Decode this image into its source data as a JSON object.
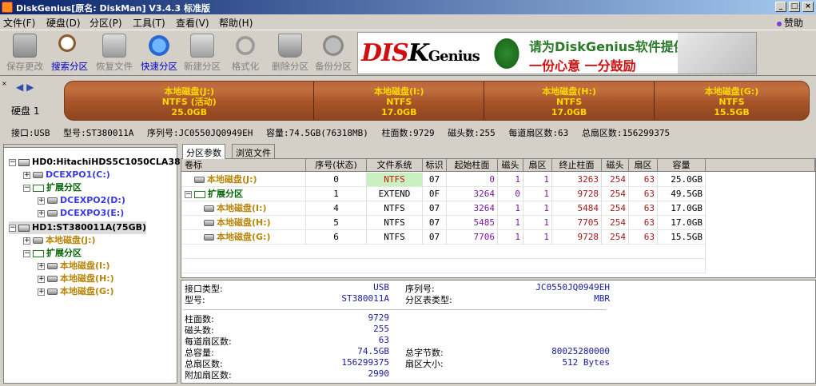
{
  "window": {
    "title": "DiskGenius[原名: DiskMan] V3.4.3 标准版",
    "controls": [
      "_",
      "□",
      "×"
    ]
  },
  "menu": {
    "items": [
      "文件(F)",
      "硬盘(D)",
      "分区(P)",
      "工具(T)",
      "查看(V)",
      "帮助(H)"
    ],
    "donate": "赞助"
  },
  "toolbar": {
    "buttons": [
      {
        "label": "保存更改",
        "icon": "save-icon",
        "enabled": false
      },
      {
        "label": "搜索分区",
        "icon": "search-icon",
        "enabled": true
      },
      {
        "label": "恢复文件",
        "icon": "recover-icon",
        "enabled": false
      },
      {
        "label": "快速分区",
        "icon": "quick-partition-icon",
        "enabled": true
      },
      {
        "label": "新建分区",
        "icon": "new-partition-icon",
        "enabled": false
      },
      {
        "label": "格式化",
        "icon": "format-icon",
        "enabled": false
      },
      {
        "label": "删除分区",
        "icon": "delete-partition-icon",
        "enabled": false
      },
      {
        "label": "备份分区",
        "icon": "backup-partition-icon",
        "enabled": false
      }
    ],
    "banner": {
      "logo_dis": "DIS",
      "logo_k": "K",
      "logo_genius": "Genius",
      "line1": "请为DiskGenius软件提供赞助",
      "line2": "一份心意  一分鼓励"
    }
  },
  "disk_bar": {
    "label": "硬盘 1",
    "segments": [
      {
        "name": "本地磁盘(J:)",
        "fs": "NTFS (活动)",
        "size": "25.0GB",
        "size_gb": 25.0
      },
      {
        "name": "本地磁盘(I:)",
        "fs": "NTFS",
        "size": "17.0GB",
        "size_gb": 17.0
      },
      {
        "name": "本地磁盘(H:)",
        "fs": "NTFS",
        "size": "17.0GB",
        "size_gb": 17.0
      },
      {
        "name": "本地磁盘(G:)",
        "fs": "NTFS",
        "size": "15.5GB",
        "size_gb": 15.5
      }
    ]
  },
  "info_line": {
    "interface": "接口:USB",
    "model": "型号:ST380011A",
    "serial": "序列号:JC0550JQ0949EH",
    "capacity": "容量:74.5GB(76318MB)",
    "cylinders": "柱面数:9729",
    "heads": "磁头数:255",
    "sectors_per_track": "每道扇区数:63",
    "total_sectors": "总扇区数:156299375"
  },
  "tree": {
    "hd0": "HD0:HitachiHDS5C1050CLA38",
    "hd0_children": [
      "DCEXPO1(C:)",
      "扩展分区",
      "DCEXPO2(D:)",
      "DCEXPO3(E:)"
    ],
    "hd1": "HD1:ST380011A(75GB)",
    "hd1_children": [
      "本地磁盘(J:)",
      "扩展分区",
      "本地磁盘(I:)",
      "本地磁盘(H:)",
      "本地磁盘(G:)"
    ]
  },
  "tabs": [
    "分区参数",
    "浏览文件"
  ],
  "partition_table": {
    "headers": [
      "卷标",
      "序号(状态)",
      "文件系统",
      "标识",
      "起始柱面",
      "磁头",
      "扇区",
      "终止柱面",
      "磁头",
      "扇区",
      "容量"
    ],
    "rows": [
      {
        "label": "本地磁盘(J:)",
        "index": "0",
        "fs": "NTFS",
        "id": "07",
        "start_cyl": "0",
        "start_head": "1",
        "start_sec": "1",
        "end_cyl": "3263",
        "end_head": "254",
        "end_sec": "63",
        "capacity": "25.0GB"
      },
      {
        "label": "扩展分区",
        "index": "1",
        "fs": "EXTEND",
        "id": "0F",
        "start_cyl": "3264",
        "start_head": "0",
        "start_sec": "1",
        "end_cyl": "9728",
        "end_head": "254",
        "end_sec": "63",
        "capacity": "49.5GB"
      },
      {
        "label": "本地磁盘(I:)",
        "index": "4",
        "fs": "NTFS",
        "id": "07",
        "start_cyl": "3264",
        "start_head": "1",
        "start_sec": "1",
        "end_cyl": "5484",
        "end_head": "254",
        "end_sec": "63",
        "capacity": "17.0GB"
      },
      {
        "label": "本地磁盘(H:)",
        "index": "5",
        "fs": "NTFS",
        "id": "07",
        "start_cyl": "5485",
        "start_head": "1",
        "start_sec": "1",
        "end_cyl": "7705",
        "end_head": "254",
        "end_sec": "63",
        "capacity": "17.0GB"
      },
      {
        "label": "本地磁盘(G:)",
        "index": "6",
        "fs": "NTFS",
        "id": "07",
        "start_cyl": "7706",
        "start_head": "1",
        "start_sec": "1",
        "end_cyl": "9728",
        "end_head": "254",
        "end_sec": "63",
        "capacity": "15.5GB"
      }
    ]
  },
  "details": {
    "interface_label": "接口类型:",
    "interface_value": "USB",
    "serial_label": "序列号:",
    "serial_value": "JC0550JQ0949EH",
    "model_label": "型号:",
    "model_value": "ST380011A",
    "pt_type_label": "分区表类型:",
    "pt_type_value": "MBR",
    "cylinders_label": "柱面数:",
    "cylinders_value": "9729",
    "heads_label": "磁头数:",
    "heads_value": "255",
    "spt_label": "每道扇区数:",
    "spt_value": "63",
    "capacity_label": "总容量:",
    "capacity_value": "74.5GB",
    "total_bytes_label": "总字节数:",
    "total_bytes_value": "80025280000",
    "total_sectors_label": "总扇区数:",
    "total_sectors_value": "156299375",
    "sector_size_label": "扇区大小:",
    "sector_size_value": "512 Bytes",
    "extra_sectors_label": "附加扇区数:",
    "extra_sectors_value": "2990"
  },
  "colors": {
    "title_gradient_start": "#0a246a",
    "partition_bar": "#a65428",
    "partition_text": "#ffd800",
    "fs_highlight": "#c8f0c0"
  }
}
